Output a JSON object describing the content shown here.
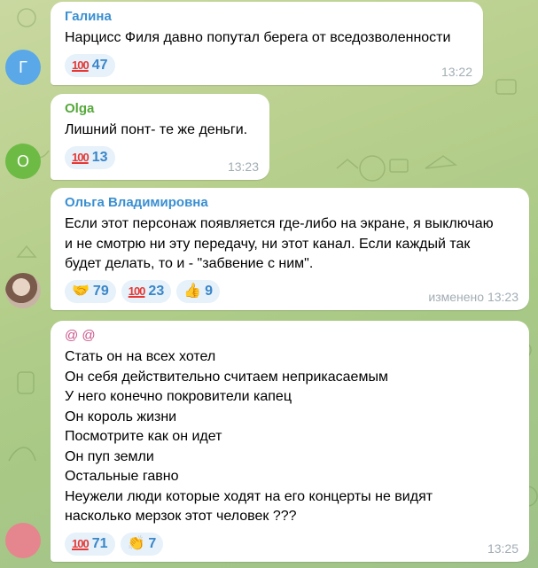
{
  "messages": [
    {
      "avatar_letter": "Г",
      "avatar_color": "#5aa8e8",
      "sender": "Галина",
      "sender_color": "#3a8fd1",
      "text_lines": [
        "Нарцисс Филя давно попутал берега от вседозволенности"
      ],
      "reactions": [
        {
          "emoji": "hundred-points",
          "count": "47"
        }
      ],
      "time": "13:22"
    },
    {
      "avatar_letter": "O",
      "avatar_color": "#6dbb45",
      "sender": "Olga",
      "sender_color": "#55a83a",
      "text_lines": [
        "Лишний понт- те же деньги."
      ],
      "reactions": [
        {
          "emoji": "hundred-points",
          "count": "13"
        }
      ],
      "time": "13:23"
    },
    {
      "avatar_letter": "",
      "avatar_color": "#b89a86",
      "sender": "Ольга Владимировна",
      "sender_color": "#3a8fd1",
      "text_lines": [
        "Если этот персонаж появляется где-либо на экране, я выключаю",
        "и не смотрю ни эту передачу, ни этот канал. Если каждый так",
        "будет делать, то и - \"забвение с ним\"."
      ],
      "reactions": [
        {
          "emoji": "handshake",
          "count": "79"
        },
        {
          "emoji": "hundred-points",
          "count": "23"
        },
        {
          "emoji": "thumbs-up",
          "count": "9"
        }
      ],
      "time": "изменено 13:23"
    },
    {
      "avatar_letter": "",
      "avatar_color": "#e5868f",
      "sender": "@ @",
      "sender_color": "#c9548a",
      "text_lines": [
        "Стать он на всех хотел",
        "Он себя действительно считаем неприкасаемым",
        "У него конечно покровители капец",
        "Он король жизни",
        "Посмотрите как он идет",
        "Он пуп земли",
        "Остальные гавно",
        "Неужели люди которые ходят на его концерты не видят",
        "насколько мерзок этот человек ???"
      ],
      "reactions": [
        {
          "emoji": "hundred-points",
          "count": "71"
        },
        {
          "emoji": "clapping-hands",
          "count": "7"
        }
      ],
      "time": "13:25"
    }
  ]
}
